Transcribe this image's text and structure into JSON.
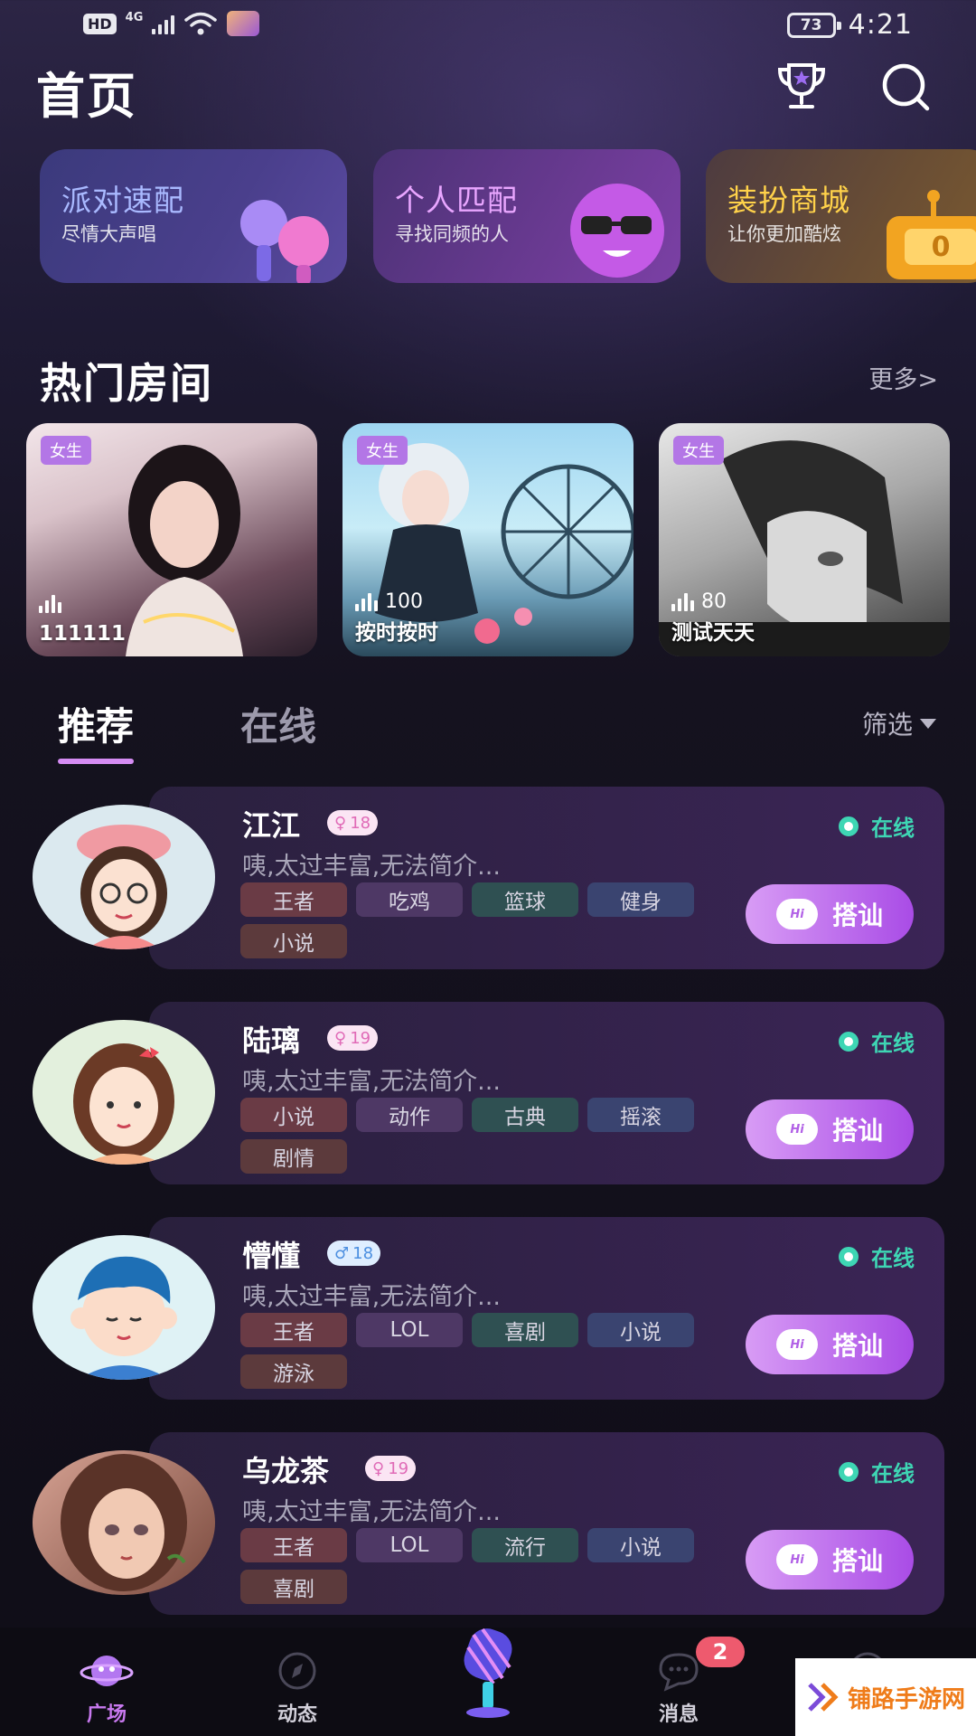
{
  "status_bar": {
    "hd": "HD",
    "network": "4G",
    "battery": "73",
    "time": "4:21"
  },
  "header": {
    "title": "首页"
  },
  "quick_cards": [
    {
      "title": "派对速配",
      "subtitle": "尽情大声唱",
      "title_color": "#a9b9ff"
    },
    {
      "title": "个人匹配",
      "subtitle": "寻找同频的人",
      "title_color": "#e9a6ff"
    },
    {
      "title": "装扮商城",
      "subtitle": "让你更加酷炫",
      "title_color": "#ffd24a"
    }
  ],
  "hot_rooms": {
    "title": "热门房间",
    "more": "更多>",
    "rooms": [
      {
        "tag": "女生",
        "count": "",
        "name": "111111"
      },
      {
        "tag": "女生",
        "count": "100",
        "name": "按时按时"
      },
      {
        "tag": "女生",
        "count": "80",
        "name": "测试天天"
      }
    ]
  },
  "tabs": {
    "recommend": "推荐",
    "online": "在线",
    "filter": "筛选"
  },
  "users": [
    {
      "name": "江江",
      "age": "18",
      "gender": "female",
      "bio": "咦,太过丰富,无法简介...",
      "tags": [
        "王者",
        "吃鸡",
        "篮球",
        "健身",
        "小说"
      ],
      "status": "在线",
      "action": "搭讪"
    },
    {
      "name": "陆璃",
      "age": "19",
      "gender": "female",
      "bio": "咦,太过丰富,无法简介...",
      "tags": [
        "小说",
        "动作",
        "古典",
        "摇滚",
        "剧情"
      ],
      "status": "在线",
      "action": "搭讪"
    },
    {
      "name": "懵懂",
      "age": "18",
      "gender": "male",
      "bio": "咦,太过丰富,无法简介...",
      "tags": [
        "王者",
        "LOL",
        "喜剧",
        "小说",
        "游泳"
      ],
      "status": "在线",
      "action": "搭讪"
    },
    {
      "name": "乌龙茶",
      "age": "19",
      "gender": "female",
      "bio": "咦,太过丰富,无法简介...",
      "tags": [
        "王者",
        "LOL",
        "流行",
        "小说",
        "喜剧"
      ],
      "status": "在线",
      "action": "搭讪"
    }
  ],
  "bottom_nav": {
    "items": [
      {
        "label": "广场",
        "icon": "planet-icon"
      },
      {
        "label": "动态",
        "icon": "compass-icon"
      },
      {
        "label": "",
        "icon": "microphone-icon"
      },
      {
        "label": "消息",
        "icon": "chat-bubble-icon"
      },
      {
        "label": "",
        "icon": "smile-icon"
      }
    ],
    "message_badge": "2"
  },
  "watermark": "铺路手游网",
  "colors": {
    "accent": "#d58cf3",
    "online": "#3ed6b4",
    "badge": "#ee5a6e"
  }
}
